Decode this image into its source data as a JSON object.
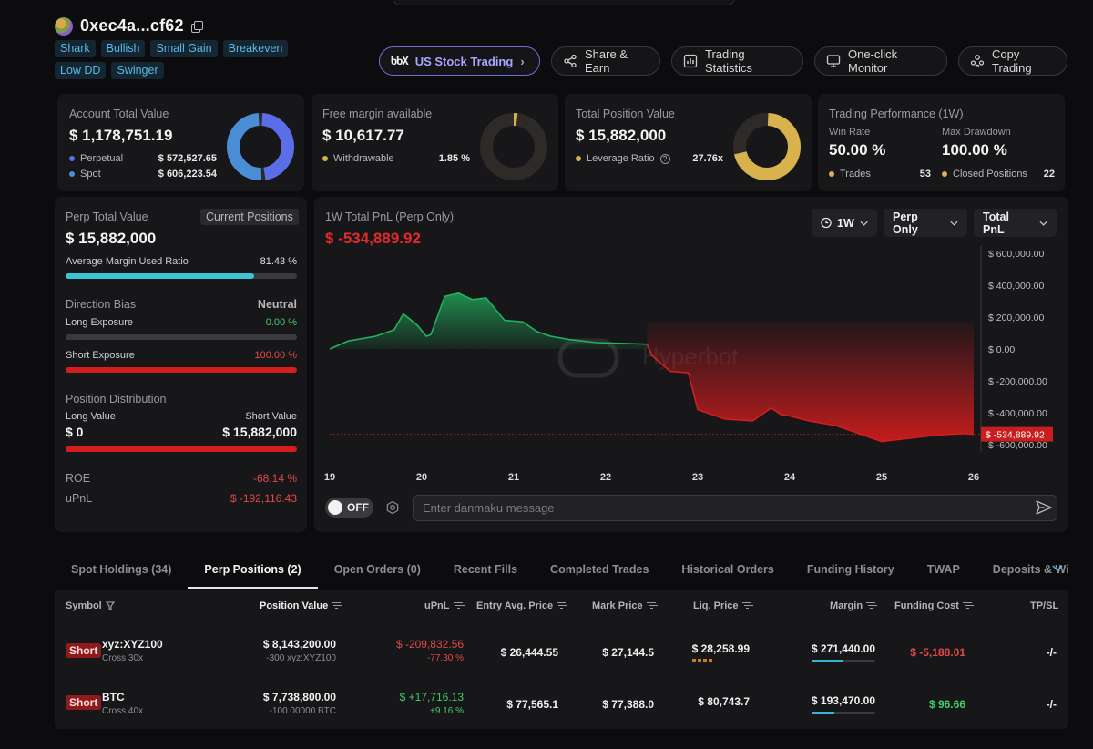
{
  "header": {
    "address": "0xec4a...cf62",
    "tags": [
      "Shark",
      "Bullish",
      "Small Gain",
      "Breakeven",
      "Low DD",
      "Swinger"
    ],
    "buttons": {
      "us_stock": "US Stock Trading",
      "share": "Share & Earn",
      "stats": "Trading Statistics",
      "monitor": "One-click Monitor",
      "copy": "Copy Trading"
    },
    "us_logo_text": "ხხX"
  },
  "cards": {
    "account": {
      "title": "Account Total Value",
      "value": "$ 1,178,751.19",
      "perp_label": "Perpetual",
      "perp_value": "$ 572,527.65",
      "spot_label": "Spot",
      "spot_value": "$ 606,223.54",
      "perp_color": "#5b6ee8",
      "spot_color": "#4a8fd6",
      "perp_share": 48.57
    },
    "free_margin": {
      "title": "Free margin available",
      "value": "$ 10,617.77",
      "withdrawable_label": "Withdrawable",
      "withdrawable_value": "1.85 %",
      "withdrawable_fraction": 0.0185,
      "color": "#d8b24c"
    },
    "position": {
      "title": "Total Position Value",
      "value": "$ 15,882,000",
      "leverage_label": "Leverage Ratio",
      "leverage_value": "27.76x",
      "color": "#d8b24c",
      "fill_fraction": 0.72
    },
    "performance": {
      "title": "Trading Performance (1W)",
      "win_rate_label": "Win Rate",
      "win_rate": "50.00 %",
      "max_dd_label": "Max Drawdown",
      "max_dd": "100.00 %",
      "trades_label": "Trades",
      "trades": "53",
      "closed_label": "Closed Positions",
      "closed": "22"
    }
  },
  "perp": {
    "title": "Perp Total Value",
    "badge": "Current Positions",
    "value": "$ 15,882,000",
    "margin_label": "Average Margin Used Ratio",
    "margin_value": "81.43 %",
    "margin_fraction": 0.8143,
    "bias_label": "Direction Bias",
    "bias_value": "Neutral",
    "long_exp_label": "Long Exposure",
    "long_exp_value": "0.00 %",
    "long_exp_fraction": 0,
    "short_exp_label": "Short Exposure",
    "short_exp_value": "100.00 %",
    "short_exp_fraction": 1.0,
    "dist_label": "Position Distribution",
    "long_value_label": "Long Value",
    "short_value_label": "Short Value",
    "long_value": "$ 0",
    "short_value": "$ 15,882,000",
    "roe_label": "ROE",
    "roe": "-68.14 %",
    "upnl_label": "uPnL",
    "upnl": "$ -192,116.43"
  },
  "pnl_chart": {
    "title": "1W Total PnL (Perp Only)",
    "value": "$ -534,889.92",
    "dropdowns": {
      "period": "1W",
      "scope": "Perp Only",
      "metric": "Total PnL"
    },
    "watermark": "Hyperbot",
    "current_label": "$ -534,889.92",
    "danmaku_toggle": "OFF",
    "danmaku_placeholder": "Enter danmaku message"
  },
  "chart_data": {
    "type": "area",
    "title": "1W Total PnL (Perp Only)",
    "xlabel": "",
    "ylabel": "",
    "x_ticks": [
      "19",
      "20",
      "21",
      "22",
      "23",
      "24",
      "25",
      "26"
    ],
    "y_ticks": [
      "$ 600,000.00",
      "$ 400,000.00",
      "$ 200,000.00",
      "$ 0.00",
      "$ -200,000.00",
      "$ -400,000.00",
      "$ -600,000.00"
    ],
    "ylim": [
      -600000,
      600000
    ],
    "xlim": [
      19,
      26
    ],
    "x": [
      19.0,
      19.2,
      19.5,
      19.7,
      19.8,
      19.95,
      20.05,
      20.1,
      20.25,
      20.4,
      20.55,
      20.7,
      20.9,
      21.1,
      21.25,
      21.4,
      21.6,
      21.9,
      22.2,
      22.45,
      22.5,
      22.7,
      22.9,
      23.0,
      23.3,
      23.6,
      23.8,
      23.9,
      24.0,
      24.2,
      24.5,
      24.8,
      25.0,
      25.3,
      25.6,
      25.9,
      26.0
    ],
    "y": [
      0,
      50000,
      80000,
      120000,
      220000,
      150000,
      80000,
      90000,
      330000,
      350000,
      310000,
      320000,
      180000,
      170000,
      110000,
      80000,
      60000,
      40000,
      35000,
      30000,
      -40000,
      -140000,
      -150000,
      -380000,
      -440000,
      -450000,
      -370000,
      -410000,
      -420000,
      -450000,
      -480000,
      -540000,
      -580000,
      -560000,
      -540000,
      -530000,
      -534889.92
    ],
    "split_x": 22.5,
    "positive_color": "#22b35e",
    "negative_color": "#d51d1d"
  },
  "tabs": [
    "Spot Holdings (34)",
    "Perp Positions (2)",
    "Open Orders (0)",
    "Recent Fills",
    "Completed Trades",
    "Historical Orders",
    "Funding History",
    "TWAP",
    "Deposits & Withdra"
  ],
  "table": {
    "headers": {
      "symbol": "Symbol",
      "position_value": "Position Value",
      "upnl": "uPnL",
      "entry": "Entry Avg. Price",
      "mark": "Mark Price",
      "liq": "Liq. Price",
      "margin": "Margin",
      "funding": "Funding Cost",
      "tpsl": "TP/SL"
    },
    "rows": [
      {
        "side": "Short",
        "symbol": "xyz:XYZ100",
        "leverage": "Cross 30x",
        "position_value": "$ 8,143,200.00",
        "position_size": "-300 xyz:XYZ100",
        "upnl": "$ -209,832.56",
        "upnl_pct": "-77.30 %",
        "entry": "$ 26,444.55",
        "mark": "$ 27,144.5",
        "liq": "$ 28,258.99",
        "margin": "$ 271,440.00",
        "margin_fraction": 0.48,
        "funding": "$ -5,188.01",
        "tpsl": "-/-"
      },
      {
        "side": "Short",
        "symbol": "BTC",
        "leverage": "Cross 40x",
        "position_value": "$ 7,738,800.00",
        "position_size": "-100.00000 BTC",
        "upnl": "$ +17,716.13",
        "upnl_pct": "+9.16 %",
        "entry": "$ 77,565.1",
        "mark": "$ 77,388.0",
        "liq": "$ 80,743.7",
        "margin": "$ 193,470.00",
        "margin_fraction": 0.35,
        "funding": "$ 96.66",
        "tpsl": "-/-"
      }
    ]
  }
}
